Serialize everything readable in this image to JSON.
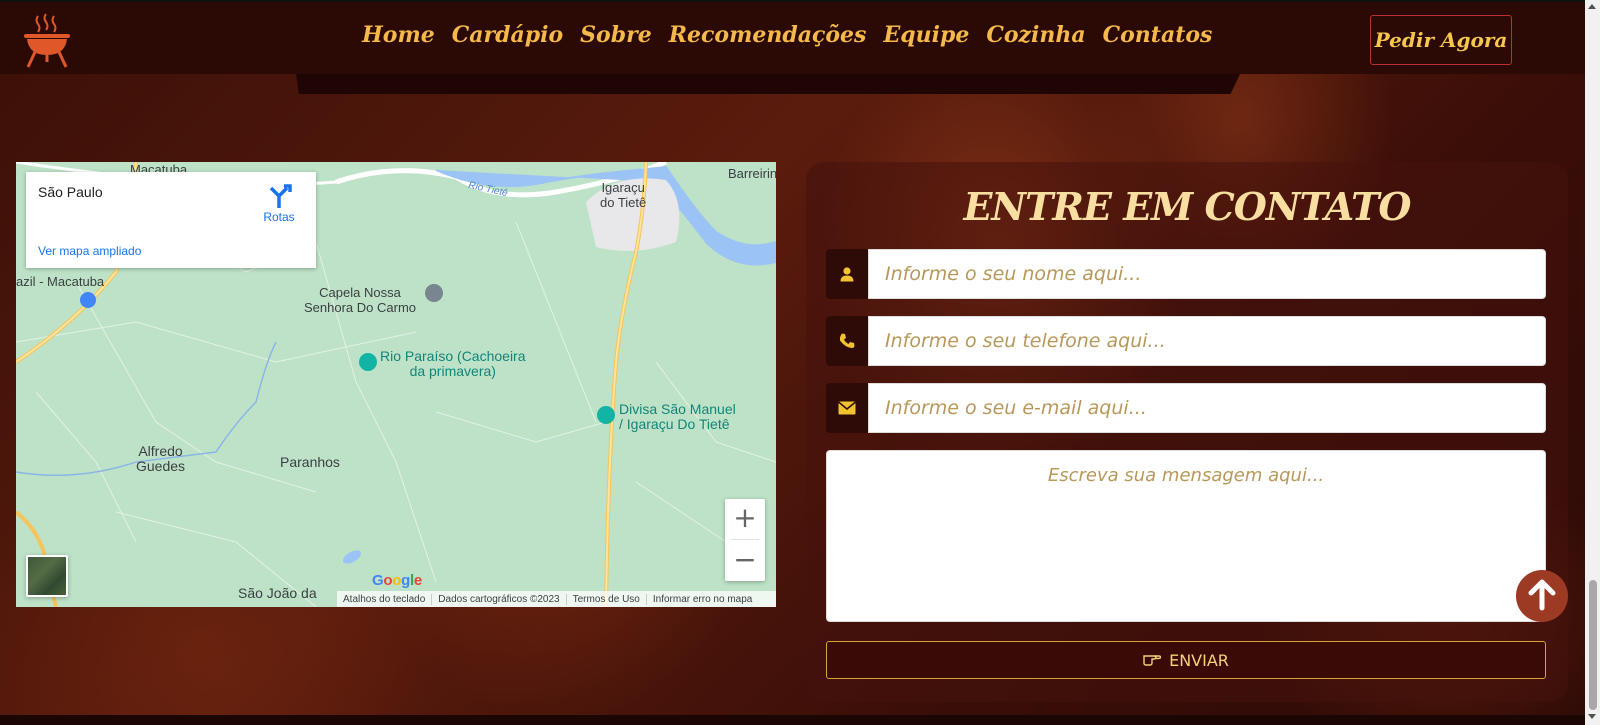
{
  "navbar": {
    "links": [
      "Home",
      "Cardápio",
      "Sobre",
      "Recomendações",
      "Equipe",
      "Cozinha",
      "Contatos"
    ],
    "order_button": "Pedir Agora"
  },
  "map": {
    "card": {
      "title": "São Paulo",
      "directions_label": "Rotas",
      "view_larger": "Ver mapa ampliado"
    },
    "labels": {
      "macatuba_top": "Macatuba",
      "rio_tiete": "Rio Tietê",
      "igaracu": "Igaraçu\ndo Tietê",
      "barreira": "Barreirin",
      "brazil_macatuba": "azil - Macatuba",
      "capela": "Capela Nossa\nSenhora Do Carmo",
      "rio_paraiso": "Rio Paraíso (Cachoeira\nda primavera)",
      "divisa": "Divisa São Manuel\n/ Igaraçu Do Tietê",
      "alfredo": "Alfredo\nGuedes",
      "paranhos": "Paranhos",
      "sao_joao": "São João da"
    },
    "zoom_in": "+",
    "zoom_out": "−",
    "google": "Google",
    "footer": [
      "Atalhos do teclado",
      "Dados cartográficos ©2023",
      "Termos de Uso",
      "Informar erro no mapa"
    ]
  },
  "contact": {
    "title": "ENTRE EM CONTATO",
    "name_placeholder": "Informe o seu nome aqui...",
    "phone_placeholder": "Informe o seu telefone aqui...",
    "email_placeholder": "Informe o seu e-mail aqui...",
    "message_placeholder": "Escreva sua mensagem aqui...",
    "send_label": "ENVIAR"
  },
  "icons": {
    "logo": "grill-icon",
    "name": "user-icon",
    "phone": "phone-icon",
    "email": "envelope-icon",
    "send": "hand-pointer-icon",
    "back_to_top": "arrow-up-icon"
  },
  "colors": {
    "accent": "#f5b84a",
    "title": "#f8dfa1",
    "navbar_bg": "#2b0a05",
    "icon_yellow": "#f2c230",
    "back_to_top": "#9c3a24"
  }
}
